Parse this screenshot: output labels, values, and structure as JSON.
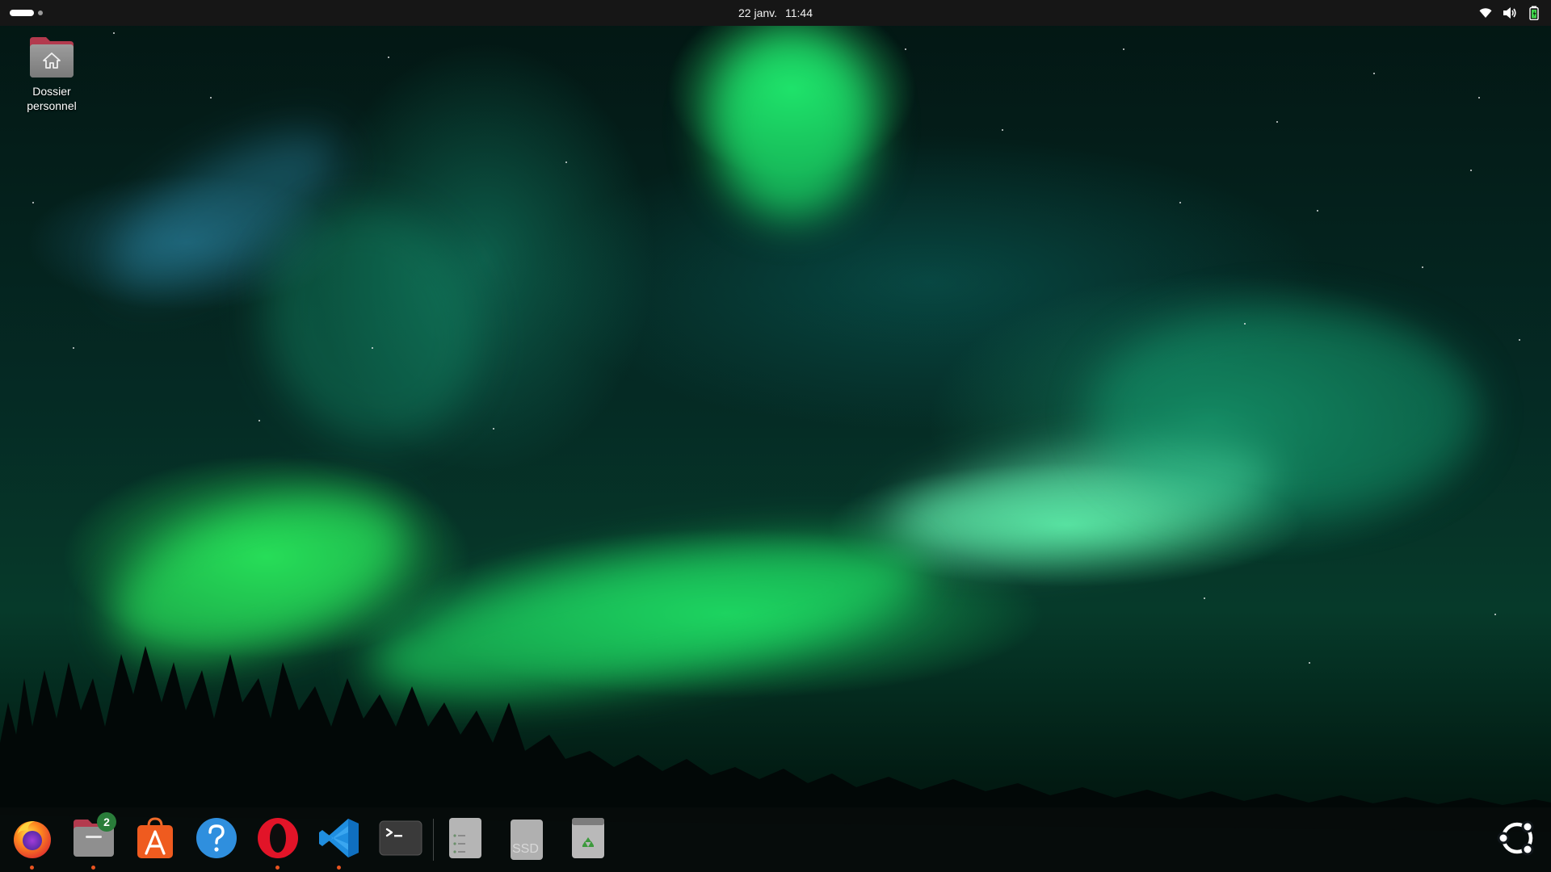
{
  "topbar": {
    "date": "22 janv.",
    "time": "11:44",
    "tray_icons": [
      "wifi-icon",
      "volume-icon",
      "battery-icon"
    ]
  },
  "desktop": {
    "icons": [
      {
        "label_line1": "Dossier",
        "label_line2": "personnel",
        "icon": "home-folder-icon"
      }
    ]
  },
  "dock": {
    "apps": [
      {
        "name": "Firefox",
        "icon": "firefox-icon",
        "running": true
      },
      {
        "name": "Fichiers",
        "icon": "files-icon",
        "running": true,
        "badge": "2"
      },
      {
        "name": "App Center",
        "icon": "app-center-icon",
        "running": false
      },
      {
        "name": "Aide",
        "icon": "help-icon",
        "running": false
      },
      {
        "name": "Opera",
        "icon": "opera-icon",
        "running": true
      },
      {
        "name": "Visual Studio Code",
        "icon": "vscode-icon",
        "running": true
      },
      {
        "name": "Terminal",
        "icon": "terminal-icon",
        "running": false
      }
    ],
    "volumes": [
      {
        "name": "Disque",
        "icon": "drive-icon"
      },
      {
        "name": "SSD",
        "icon": "ssd-icon",
        "label": "SSD"
      },
      {
        "name": "Corbeille",
        "icon": "trash-icon"
      }
    ],
    "show_apps_icon": "show-apps-icon"
  },
  "colors": {
    "accent": "#e95420",
    "topbar_bg": "#161616",
    "badge_bg": "#2a7d3a"
  }
}
